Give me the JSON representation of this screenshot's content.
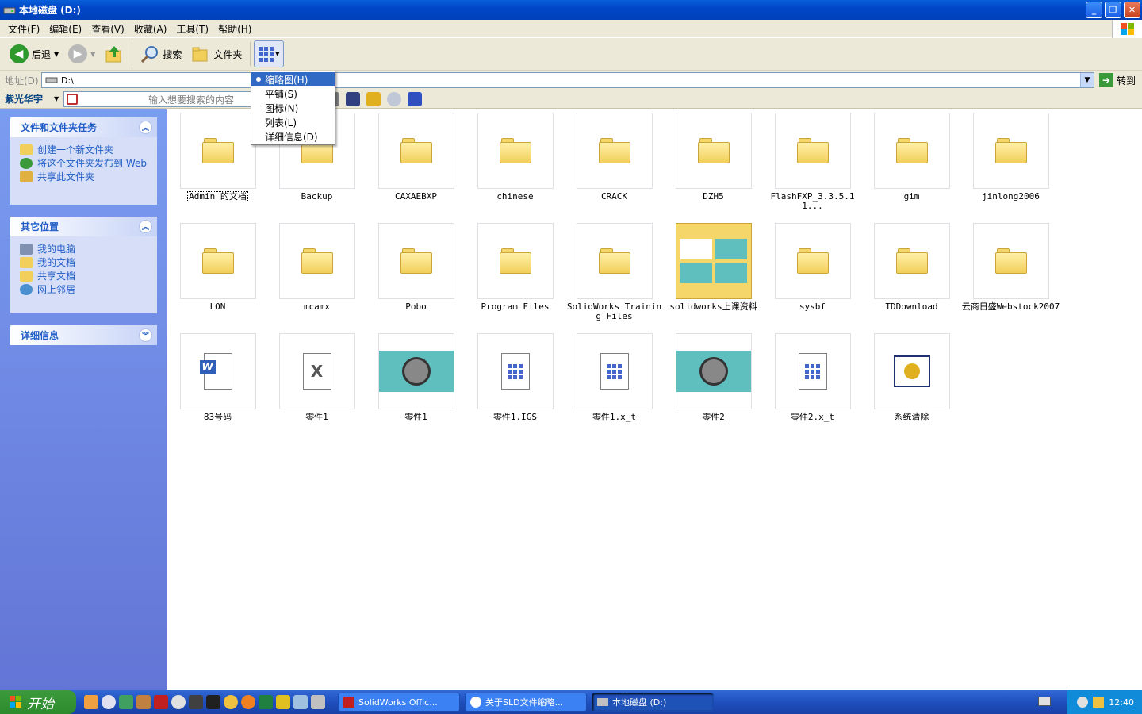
{
  "window": {
    "title": "本地磁盘 (D:)"
  },
  "menu": [
    "文件(F)",
    "编辑(E)",
    "查看(V)",
    "收藏(A)",
    "工具(T)",
    "帮助(H)"
  ],
  "toolbar": {
    "back": "后退",
    "search": "搜索",
    "folders": "文件夹"
  },
  "address": {
    "label": "地址(D)",
    "value": "D:\\",
    "go": "转到"
  },
  "searchbar": {
    "brand": "紫光华宇",
    "placeholder": "输入想要搜索的内容"
  },
  "views_menu": {
    "items": [
      "缩略图(H)",
      "平铺(S)",
      "图标(N)",
      "列表(L)",
      "详细信息(D)"
    ],
    "selected": 0
  },
  "sidebar": {
    "tasks": {
      "title": "文件和文件夹任务",
      "links": [
        "创建一个新文件夹",
        "将这个文件夹发布到 Web",
        "共享此文件夹"
      ]
    },
    "places": {
      "title": "其它位置",
      "links": [
        "我的电脑",
        "我的文档",
        "共享文档",
        "网上邻居"
      ]
    },
    "details": {
      "title": "详细信息"
    }
  },
  "files": [
    {
      "name": "Admin 的文档",
      "icon": "folder-icon"
    },
    {
      "name": "Backup",
      "icon": "folder-icon"
    },
    {
      "name": "CAXAEBXP",
      "icon": "folder-icon"
    },
    {
      "name": "chinese",
      "icon": "folder-icon"
    },
    {
      "name": "CRACK",
      "icon": "folder-icon"
    },
    {
      "name": "DZH5",
      "icon": "folder-icon"
    },
    {
      "name": "FlashFXP_3.3.5.11...",
      "icon": "folder-icon"
    },
    {
      "name": "gim",
      "icon": "folder-icon"
    },
    {
      "name": "jinlong2006",
      "icon": "folder-icon"
    },
    {
      "name": "LON",
      "icon": "folder-icon"
    },
    {
      "name": "mcamx",
      "icon": "folder-icon"
    },
    {
      "name": "Pobo",
      "icon": "folder-icon"
    },
    {
      "name": "Program Files",
      "icon": "folder-icon"
    },
    {
      "name": "SolidWorks Training Files",
      "icon": "folder-icon"
    },
    {
      "name": "solidworks上课资料",
      "icon": "folder-preview-icon"
    },
    {
      "name": "sysbf",
      "icon": "folder-icon"
    },
    {
      "name": "TDDownload",
      "icon": "folder-icon"
    },
    {
      "name": "云商日盛Webstock2007",
      "icon": "folder-icon"
    },
    {
      "name": "83号码",
      "icon": "word-doc-icon"
    },
    {
      "name": "零件1",
      "icon": "solidworks-part-icon"
    },
    {
      "name": "零件1",
      "icon": "part-thumbnail-icon"
    },
    {
      "name": "零件1.IGS",
      "icon": "generic-file-icon"
    },
    {
      "name": "零件1.x_t",
      "icon": "generic-file-icon"
    },
    {
      "name": "零件2",
      "icon": "part-thumbnail-icon"
    },
    {
      "name": "零件2.x_t",
      "icon": "generic-file-icon"
    },
    {
      "name": "系统清除",
      "icon": "program-icon"
    }
  ],
  "taskbar": {
    "start": "开始",
    "tasks": [
      "SolidWorks Offic...",
      "关于SLD文件缩略...",
      "本地磁盘 (D:)"
    ],
    "clock": "12:40"
  },
  "colors": {
    "title": "#0046c8",
    "sidebar": "#6375d6",
    "selection": "#316ac5"
  }
}
